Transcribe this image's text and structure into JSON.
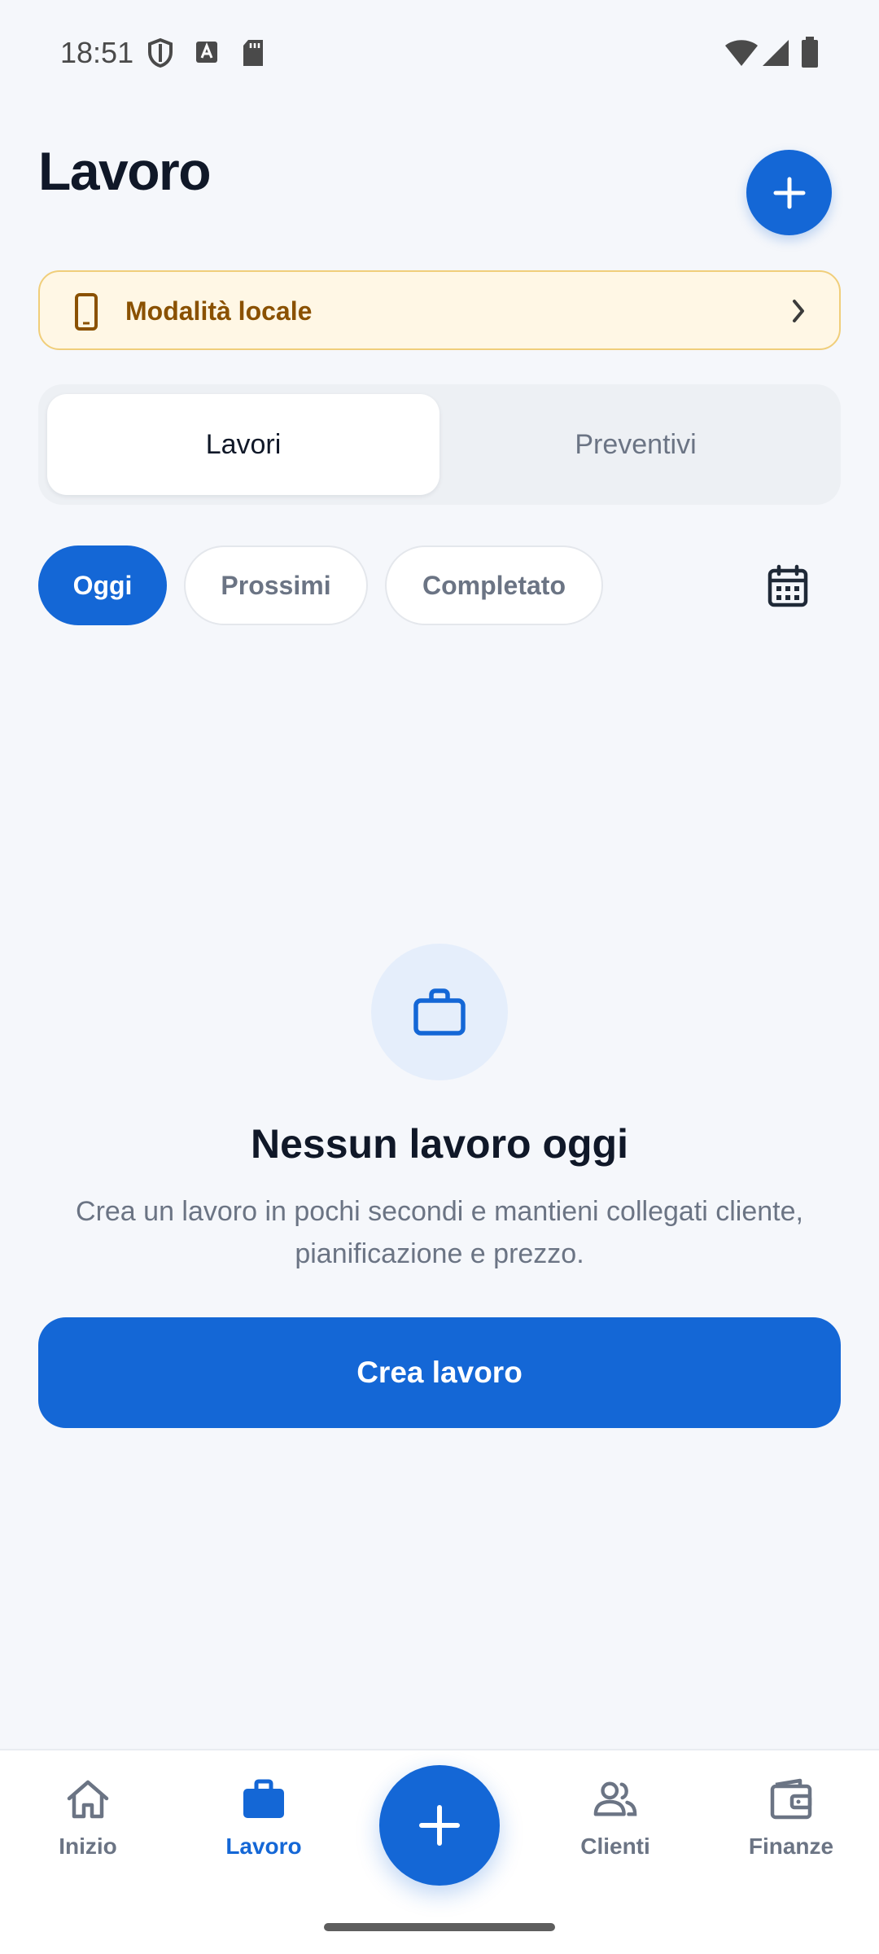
{
  "status_bar": {
    "time": "18:51"
  },
  "header": {
    "title": "Lavoro",
    "add_icon": "plus-icon"
  },
  "banner": {
    "label": "Modalità locale",
    "icon": "smartphone-icon",
    "chevron": "chevron-right-icon"
  },
  "segments": {
    "active": "Lavori",
    "inactive": "Preventivi"
  },
  "filters": {
    "chips": [
      "Oggi",
      "Prossimi",
      "Completato"
    ],
    "calendar_icon": "calendar-icon"
  },
  "empty_state": {
    "icon": "briefcase-icon",
    "title": "Nessun lavoro oggi",
    "description": "Crea un lavoro in pochi secondi e mantieni collegati cliente, pianificazione e prezzo.",
    "button": "Crea lavoro"
  },
  "bottom_nav": {
    "items": [
      {
        "label": "Inizio",
        "icon": "home-icon"
      },
      {
        "label": "Lavoro",
        "icon": "briefcase-icon",
        "active": true
      },
      {
        "label": "Clienti",
        "icon": "people-icon"
      },
      {
        "label": "Finanze",
        "icon": "wallet-icon"
      }
    ],
    "fab_icon": "plus-icon"
  },
  "colors": {
    "primary": "#1467D6",
    "background": "#F5F7FB",
    "banner_bg": "#FFF7E5",
    "banner_text": "#8A5100",
    "muted": "#6B7484"
  }
}
